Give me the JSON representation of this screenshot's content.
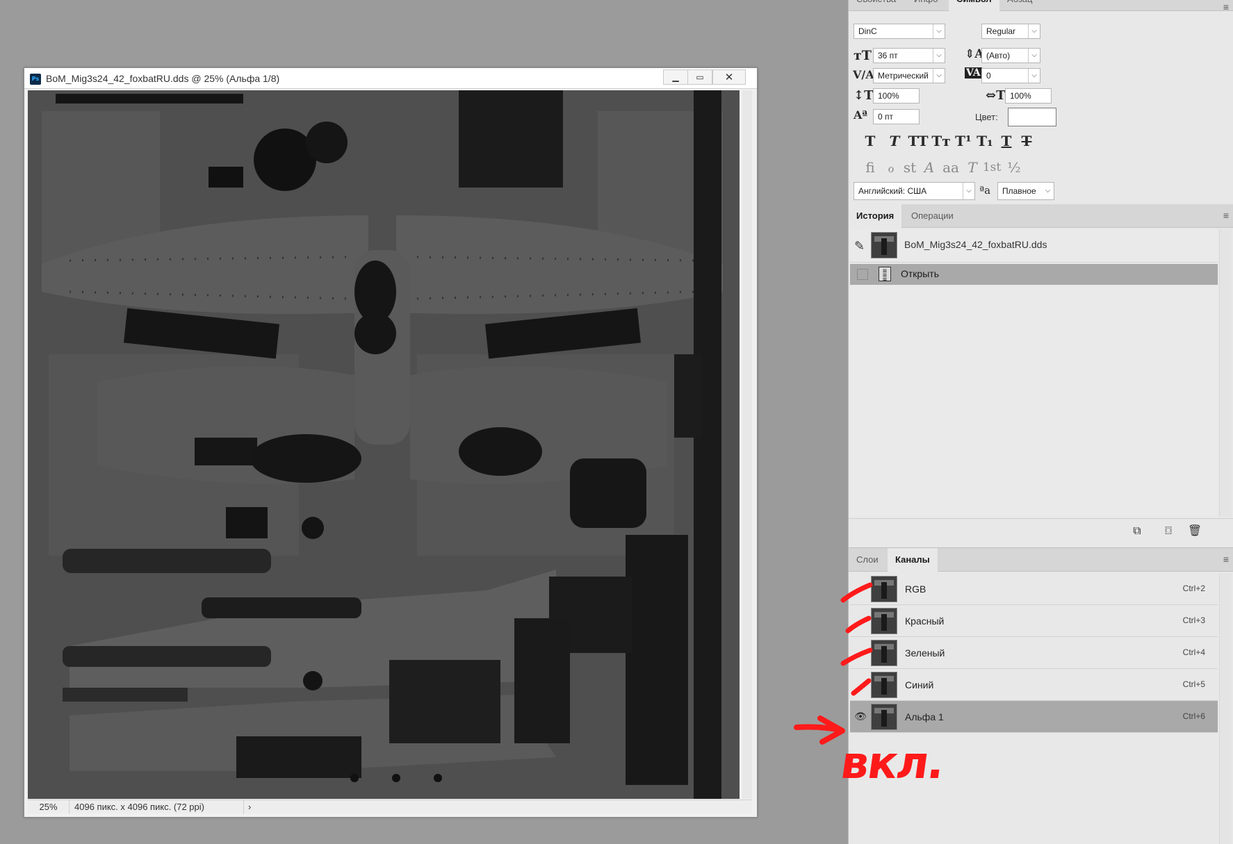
{
  "document": {
    "title": "BoM_Mig3s24_42_foxbatRU.dds @ 25% (Альфа 1/8)",
    "app_icon": "Ps",
    "window_buttons": {
      "minimize": "▁",
      "maximize": "▭",
      "close": "✕"
    },
    "zoom": "25%",
    "info": "4096 пикс. x 4096 пикс. (72 ppi)",
    "info_arrow": "›"
  },
  "character_panel": {
    "tabs": [
      "Свойства",
      "Инфо",
      "Символ",
      "Абзац"
    ],
    "active_tab": "Символ",
    "font_family": "DinC",
    "font_style": "Regular",
    "font_size": "36 пт",
    "leading": "(Авто)",
    "kerning": "Метрический",
    "tracking": "0",
    "vertical_scale": "100%",
    "horizontal_scale": "100%",
    "baseline_shift": "0 пт",
    "color_label": "Цвет:",
    "color_value": "#ffffff",
    "style_buttons": [
      "T",
      "T",
      "TT",
      "Tт",
      "T¹",
      "T₁",
      "T",
      "T"
    ],
    "opentype_buttons": [
      "fi",
      "ℴ",
      "st",
      "A",
      "aa",
      "T",
      "1st",
      "½"
    ],
    "language": "Английский: США",
    "aa_icon": "ªa",
    "antialias": "Плавное"
  },
  "history_panel": {
    "tabs": [
      "История",
      "Операции"
    ],
    "active_tab": "История",
    "snapshot_name": "BoM_Mig3s24_42_foxbatRU.dds",
    "states": [
      {
        "label": "Открыть"
      }
    ],
    "footer_buttons": [
      "new-document-from-state",
      "snapshot",
      "delete"
    ]
  },
  "channels_panel": {
    "tabs": [
      "Слои",
      "Каналы"
    ],
    "active_tab": "Каналы",
    "channels": [
      {
        "name": "RGB",
        "shortcut": "Ctrl+2",
        "visible": false,
        "selected": false
      },
      {
        "name": "Красный",
        "shortcut": "Ctrl+3",
        "visible": false,
        "selected": false
      },
      {
        "name": "Зеленый",
        "shortcut": "Ctrl+4",
        "visible": false,
        "selected": false
      },
      {
        "name": "Синий",
        "shortcut": "Ctrl+5",
        "visible": false,
        "selected": false
      },
      {
        "name": "Альфа 1",
        "shortcut": "Ctrl+6",
        "visible": true,
        "selected": true
      }
    ]
  },
  "annotation": {
    "text": "вкл.",
    "color": "#ff1a1a"
  },
  "colors": {
    "workspace_bg": "#9b9b9b",
    "panel_bg": "#e8e8e8",
    "selected_row": "#a9a9a9",
    "canvas_dark": "#4a4a4a"
  }
}
